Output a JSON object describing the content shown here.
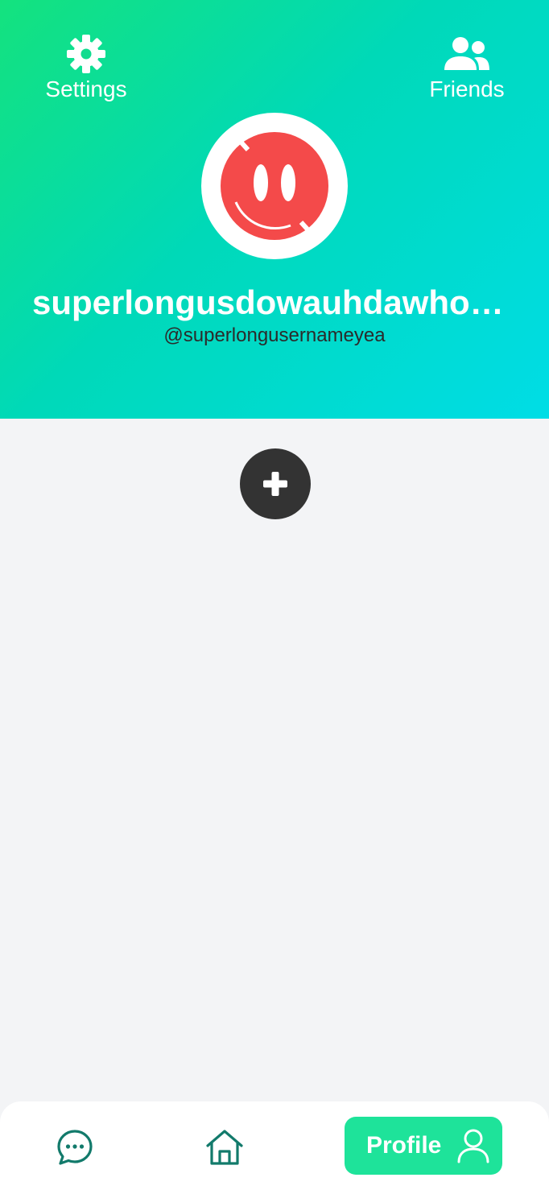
{
  "header": {
    "settings_label": "Settings",
    "friends_label": "Friends",
    "display_name": "superlongusdowauhdawhou…",
    "handle": "@superlongusernameyea",
    "gradient_start": "#14e27e",
    "gradient_end": "#00dde6"
  },
  "content": {
    "add_icon": "plus-icon"
  },
  "bottom_nav": {
    "items": [
      {
        "icon": "chat-icon"
      },
      {
        "icon": "home-icon"
      },
      {
        "icon": "user-icon",
        "label": "Profile",
        "active": true
      }
    ],
    "active_color": "#1ee39a",
    "icon_color": "#127a6b"
  },
  "avatar": {
    "color": "#f44a4a"
  }
}
